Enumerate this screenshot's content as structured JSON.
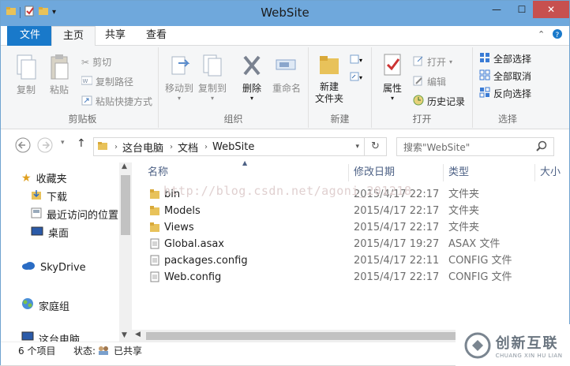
{
  "window": {
    "title": "WebSite",
    "minimize": "—",
    "maximize": "☐",
    "close": "✕"
  },
  "tabs": {
    "file": "文件",
    "home": "主页",
    "share": "共享",
    "view": "查看"
  },
  "ribbon": {
    "clipboard": {
      "label": "剪贴板",
      "copy": "复制",
      "paste": "粘贴",
      "cut": "剪切",
      "copy_path": "复制路径",
      "paste_shortcut": "粘贴快捷方式"
    },
    "organize": {
      "label": "组织",
      "move_to": "移动到",
      "copy_to": "复制到",
      "delete": "删除",
      "rename": "重命名"
    },
    "new": {
      "label": "新建",
      "new_folder": "新建\n文件夹"
    },
    "open": {
      "label": "打开",
      "properties": "属性",
      "open": "打开",
      "edit": "编辑",
      "history": "历史记录"
    },
    "select": {
      "label": "选择",
      "select_all": "全部选择",
      "select_none": "全部取消",
      "invert": "反向选择"
    }
  },
  "address": {
    "segments": [
      "这台电脑",
      "文档",
      "WebSite"
    ],
    "search_placeholder": "搜索\"WebSite\""
  },
  "nav": {
    "favorites": "收藏夹",
    "downloads": "下载",
    "recent": "最近访问的位置",
    "desktop": "桌面",
    "skydrive": "SkyDrive",
    "homegroup": "家庭组",
    "thispc": "这台电脑"
  },
  "columns": {
    "name": "名称",
    "date": "修改日期",
    "type": "类型",
    "size": "大小"
  },
  "files": [
    {
      "name": "bin",
      "date": "2015/4/17 22:17",
      "type": "文件夹",
      "icon": "folder-icon"
    },
    {
      "name": "Models",
      "date": "2015/4/17 22:17",
      "type": "文件夹",
      "icon": "folder-icon"
    },
    {
      "name": "Views",
      "date": "2015/4/17 22:17",
      "type": "文件夹",
      "icon": "folder-icon"
    },
    {
      "name": "Global.asax",
      "date": "2015/4/17 19:27",
      "type": "ASAX 文件",
      "icon": "file-icon"
    },
    {
      "name": "packages.config",
      "date": "2015/4/17 22:11",
      "type": "CONFIG 文件",
      "icon": "file-icon"
    },
    {
      "name": "Web.config",
      "date": "2015/4/17 22:17",
      "type": "CONFIG 文件",
      "icon": "file-icon"
    }
  ],
  "status": {
    "count": "6 个项目",
    "state_label": "状态:",
    "state": "已共享"
  },
  "watermark": "http://blog.csdn.net/agoni_201218",
  "logo": {
    "main": "创新互联",
    "sub": "CHUANG XIN HU LIAN"
  },
  "colors": {
    "accent": "#1979ca",
    "titlebar": "#6fa8dc",
    "close": "#c7504f",
    "folder": "#e8c25a"
  }
}
